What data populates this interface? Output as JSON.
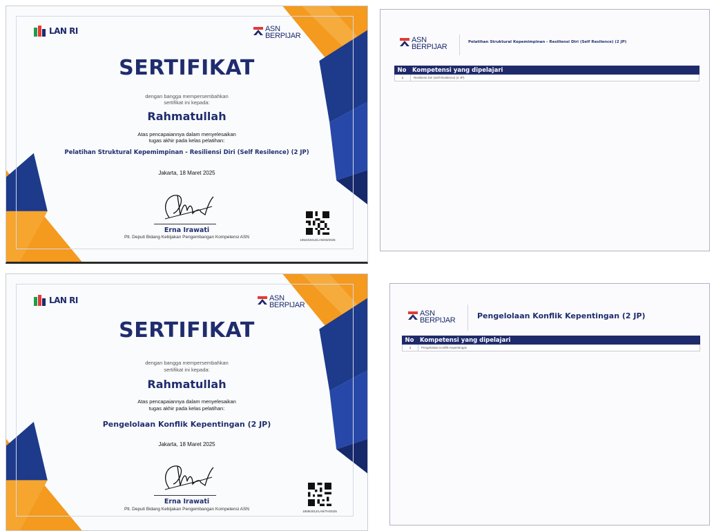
{
  "colors": {
    "navy": "#1f2d6e",
    "orange": "#f39a1f",
    "blue": "#1e3a8a",
    "table_header": "#1f2a6b"
  },
  "logos": {
    "lan": "LAN RI",
    "asn_line1": "ASN",
    "asn_line2": "BERPIJAR"
  },
  "certificates": [
    {
      "title": "SERTIFIKAT",
      "intro_1": "dengan bangga mempersembahkan",
      "intro_2": "sertifikat ini kepada:",
      "recipient": "Rahmatullah",
      "achieve_1": "Atas pencapaiannya dalam menyelesaikan",
      "achieve_2": "tugas akhir pada kelas pelatihan:",
      "course": "Pelatihan Struktural Kepemimpinan - Resiliensi Diri (Self Resilence) (2 JP)",
      "date": "Jakarta, 18 Maret 2025",
      "signer": "Erna Irawati",
      "signer_role": "Plt. Deputi Bidang Kebijakan Pengembangan Kompetensi ASN",
      "cert_number": "10523/4012/LAN/03/2025"
    },
    {
      "title": "SERTIFIKAT",
      "intro_1": "dengan bangga mempersembahkan",
      "intro_2": "sertifikat ini kepada:",
      "recipient": "Rahmatullah",
      "achieve_1": "Atas pencapaiannya dalam menyelesaikan",
      "achieve_2": "tugas akhir pada kelas pelatihan:",
      "course": "Pengelolaan Konflik Kepentingan (2 JP)",
      "date": "Jakarta, 18 Maret 2025",
      "signer": "Erna Irawati",
      "signer_role": "Plt. Deputi Bidang Kebijakan Pengembangan Kompetensi ASN",
      "cert_number": "1808/4012/LAN/TH/2025"
    }
  ],
  "competency_pages": [
    {
      "heading": "Pelatihan Struktural Kepemimpinan - Resiliensi Diri (Self Resilence) (2 JP)",
      "col_no": "No",
      "col_competency": "Kompetensi yang dipelajari",
      "rows": [
        {
          "no": "1",
          "competency": "Resiliensi Diri (Self Resilence) (2 JP)"
        }
      ]
    },
    {
      "heading": "Pengelolaan Konflik Kepentingan (2 JP)",
      "col_no": "No",
      "col_competency": "Kompetensi yang dipelajari",
      "rows": [
        {
          "no": "1",
          "competency": "Pengelolaan Konflik Kepentingan"
        }
      ]
    }
  ]
}
